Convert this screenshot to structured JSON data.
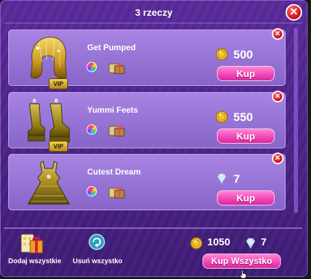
{
  "window": {
    "title": "3 rzeczy",
    "close_symbol": "✕"
  },
  "items": [
    {
      "name": "Get Pumped",
      "badge": "VIP",
      "currency": "coins",
      "price": "500",
      "buy_label": "Kup",
      "remove_symbol": "✕",
      "thumb_icon": "hair-icon"
    },
    {
      "name": "Yummi Feets",
      "badge": "VIP",
      "currency": "coins",
      "price": "550",
      "buy_label": "Kup",
      "remove_symbol": "✕",
      "thumb_icon": "boots-icon"
    },
    {
      "name": "Cutest Dream",
      "badge": "",
      "currency": "diamonds",
      "price": "7",
      "buy_label": "Kup",
      "remove_symbol": "✕",
      "thumb_icon": "dress-icon"
    }
  ],
  "footer": {
    "add_all_label": "Dodaj wszystkie",
    "remove_all_label": "Usuń wszystko",
    "total_coins": "1050",
    "total_diamonds": "7",
    "buy_all_label": "Kup Wszystko"
  },
  "colors": {
    "accent": "#f24ab8",
    "panel": "#4d2489",
    "card": "#9675d6",
    "gold": "#e8b923",
    "close": "#d20f1f"
  }
}
